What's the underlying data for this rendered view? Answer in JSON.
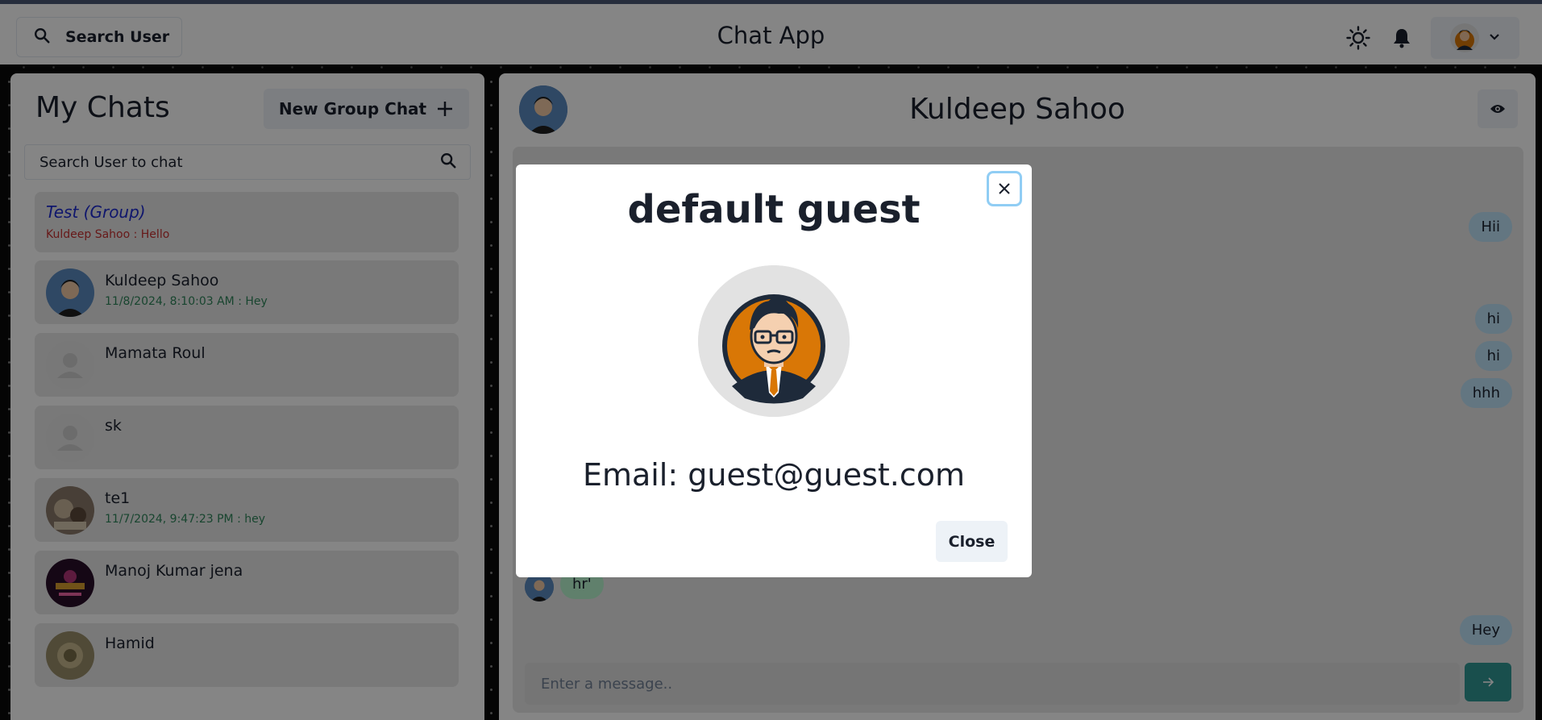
{
  "header": {
    "search_label": "Search User",
    "app_title": "Chat App"
  },
  "sidebar": {
    "title": "My Chats",
    "new_group_label": "New Group Chat",
    "search_value": "Search User to chat",
    "chats": [
      {
        "name": "Test (Group)",
        "latest": "Kuldeep Sahoo : Hello",
        "is_group": true
      },
      {
        "name": "Kuldeep Sahoo",
        "latest": "11/8/2024, 8:10:03 AM : Hey",
        "avatar": "boy-avatar"
      },
      {
        "name": "Mamata Roul",
        "latest": "",
        "avatar": "default-avatar"
      },
      {
        "name": "sk",
        "latest": "",
        "avatar": "default-avatar"
      },
      {
        "name": "te1",
        "latest": "11/7/2024, 9:47:23 PM : hey",
        "avatar": "photo-avatar"
      },
      {
        "name": "Manoj Kumar jena",
        "latest": "",
        "avatar": "photo-avatar"
      },
      {
        "name": "Hamid",
        "latest": "",
        "avatar": "photo-avatar"
      }
    ]
  },
  "chat": {
    "title": "Kuldeep Sahoo",
    "messages": [
      {
        "text": "Hii",
        "sent": true
      },
      {
        "text": "hi",
        "sent": true
      },
      {
        "text": "hi",
        "sent": true
      },
      {
        "text": "hhh",
        "sent": true
      },
      {
        "text": "hr'",
        "sent": false
      },
      {
        "text": "Hey",
        "sent": true
      }
    ],
    "input_placeholder": "Enter a message.."
  },
  "modal": {
    "name": "default guest",
    "email": "Email: guest@guest.com",
    "close_label": "Close"
  },
  "colors": {
    "accent": "#319795",
    "sent_bubble": "#bee3f8",
    "received_bubble": "#b9f5d0",
    "group_name": "#1e2bd1",
    "group_latest": "#c53030",
    "latest_message": "#2f855a"
  }
}
